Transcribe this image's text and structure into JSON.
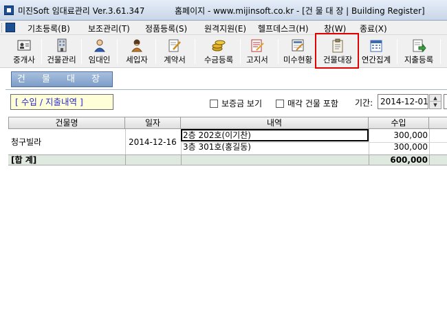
{
  "titlebar": {
    "title": "미진Soft 임대료관리 Ver.3.61.347",
    "site": "홈페이지 - www.mijinsoft.co.kr - [건 물 대 장  |  Building Register]"
  },
  "menu": [
    {
      "label": "기초등록(B)"
    },
    {
      "label": "보조관리(T)"
    },
    {
      "label": "정품등록(S)"
    },
    {
      "label": "원격지원(E)"
    },
    {
      "label": "헬프데스크(H)"
    },
    {
      "label": "창(W)"
    },
    {
      "label": "종료(X)"
    }
  ],
  "toolbar": [
    {
      "label": "중개사",
      "icon": "contact-card-icon"
    },
    {
      "label": "건물관리",
      "icon": "building-icon"
    },
    {
      "label": "임대인",
      "icon": "landlord-person-icon"
    },
    {
      "label": "세입자",
      "icon": "tenant-person-icon"
    },
    {
      "label": "계약서",
      "icon": "contract-pen-icon"
    },
    {
      "label": "수금등록",
      "icon": "coins-icon"
    },
    {
      "label": "고지서",
      "icon": "notice-icon"
    },
    {
      "label": "미수현황",
      "icon": "overdue-chart-icon"
    },
    {
      "label": "건물대장",
      "icon": "clipboard-icon"
    },
    {
      "label": "연간집계",
      "icon": "calendar-icon"
    },
    {
      "label": "지출등록",
      "icon": "expense-arrow-icon"
    }
  ],
  "page": {
    "title_button": "건 물 대 장",
    "section_label": "[ 수입 / 지출내역 ]",
    "show_deposit": "보증금 보기",
    "include_sold": "매각 건물 포함",
    "period_label": "기간:",
    "period_value": "2014-12-01"
  },
  "table": {
    "columns": [
      "건물명",
      "일자",
      "내역",
      "수입"
    ],
    "rows": [
      {
        "building": "청구빌라",
        "date": "2014-12-16",
        "detail": "2층 202호(이기찬)",
        "income": "300,000"
      },
      {
        "building": "",
        "date": "",
        "detail": "3층 301호(홍길동)",
        "income": "300,000"
      }
    ],
    "total": {
      "label": "[합 계]",
      "income": "600,000"
    }
  },
  "colors": {
    "highlight": "#e00000",
    "section_text": "#2a2ad0",
    "total_row": "#dfe9df"
  }
}
